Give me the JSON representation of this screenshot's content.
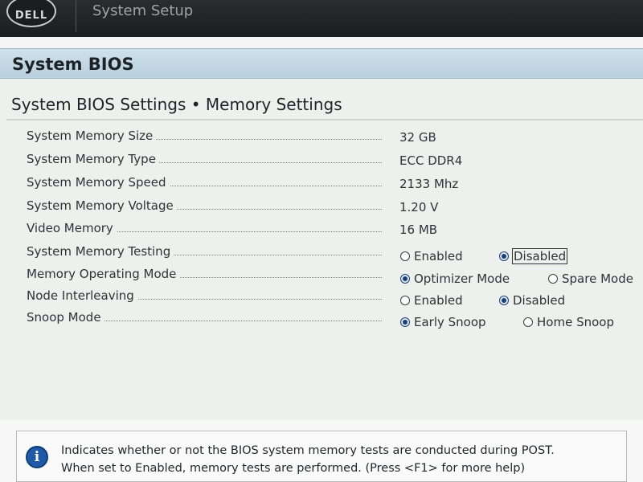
{
  "topbar": {
    "logo": "DELL",
    "title": "System Setup"
  },
  "section": {
    "title": "System BIOS"
  },
  "page": {
    "title": "System BIOS Settings • Memory Settings"
  },
  "settings": [
    {
      "label": "System Memory Size",
      "value": "32 GB"
    },
    {
      "label": "System Memory Type",
      "value": "ECC DDR4"
    },
    {
      "label": "System Memory Speed",
      "value": "2133 Mhz"
    },
    {
      "label": "System Memory Voltage",
      "value": "1.20 V"
    },
    {
      "label": "Video Memory",
      "value": "16 MB"
    },
    {
      "label": "System Memory Testing",
      "options": [
        "Enabled",
        "Disabled"
      ],
      "selected": "Disabled"
    },
    {
      "label": "Memory Operating Mode",
      "options": [
        "Optimizer Mode",
        "Spare Mode"
      ],
      "selected": "Optimizer Mode"
    },
    {
      "label": "Node Interleaving",
      "options": [
        "Enabled",
        "Disabled"
      ],
      "selected": "Disabled"
    },
    {
      "label": "Snoop Mode",
      "options": [
        "Early Snoop",
        "Home Snoop"
      ],
      "selected": "Early Snoop"
    }
  ],
  "help": {
    "icon": "info-icon",
    "line1": "Indicates whether or not the BIOS system memory tests are conducted during POST.",
    "line2": "When set to Enabled, memory tests are performed. (Press <F1> for more help)"
  }
}
